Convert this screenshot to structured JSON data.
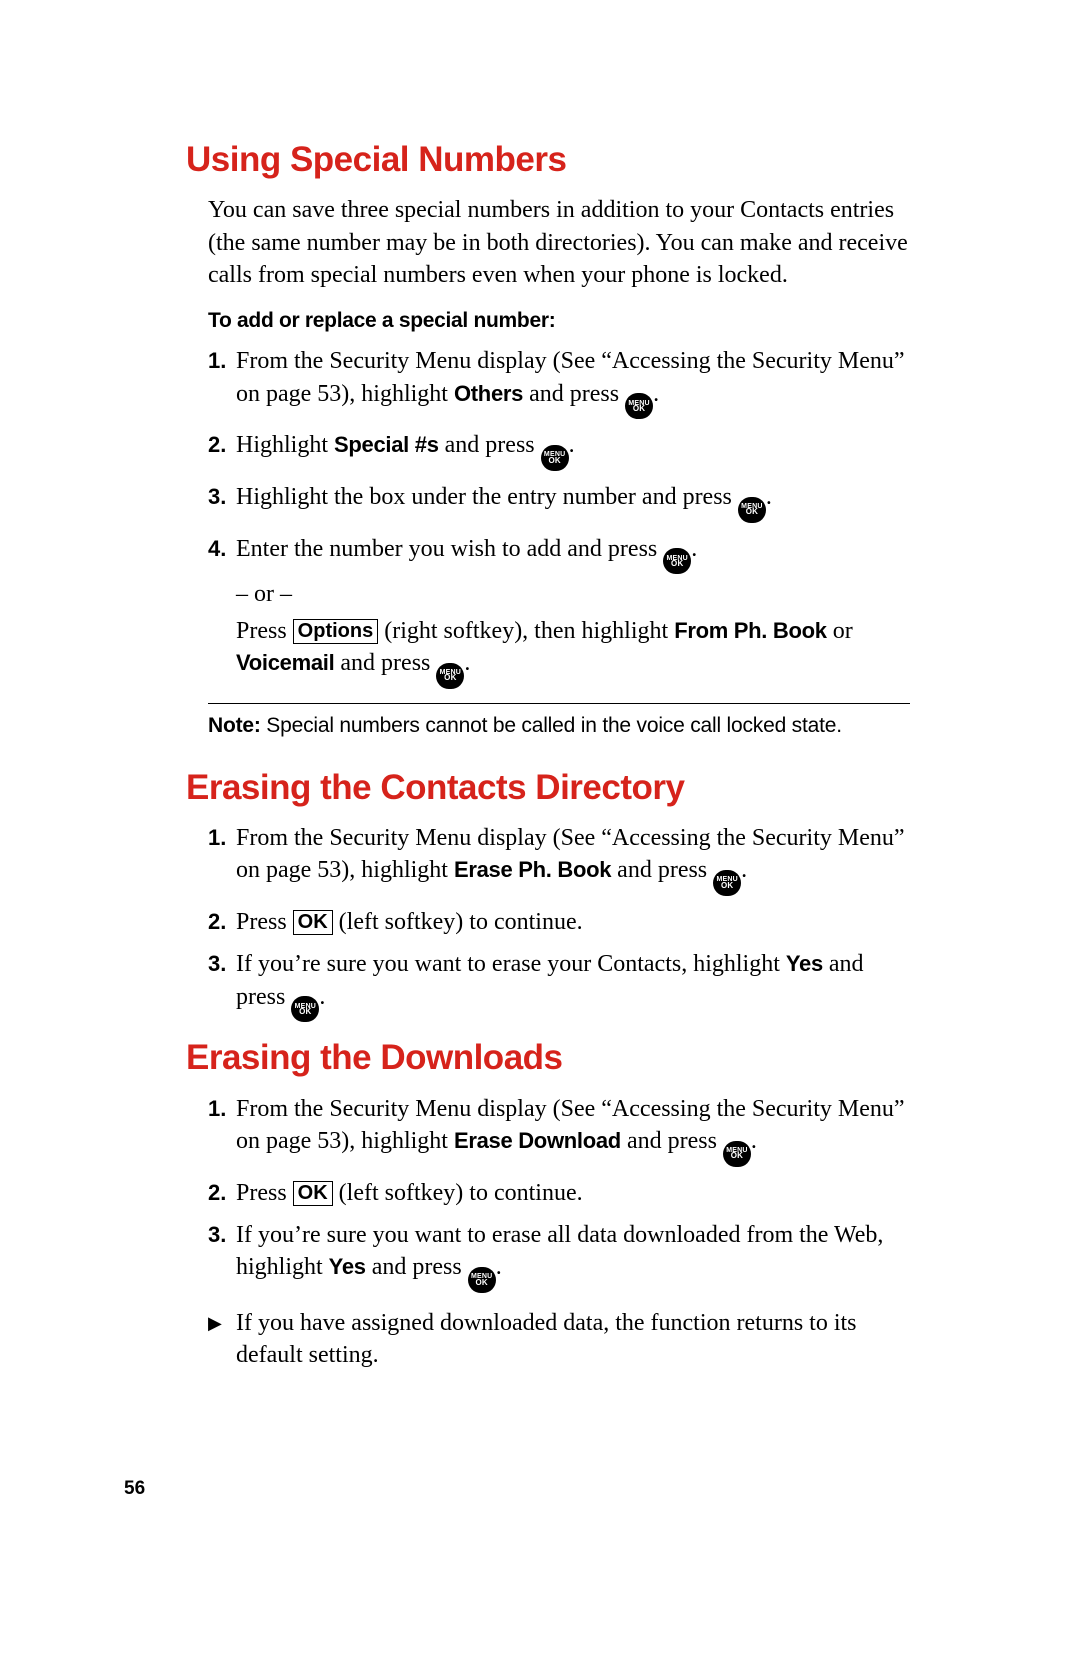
{
  "page_number": "56",
  "menu_ok_label_top": "MENU",
  "menu_ok_label_bottom": "OK",
  "sections": {
    "s1": {
      "heading": "Using Special Numbers",
      "intro": "You can save three special numbers in addition to your Contacts entries (the same number may be in both directories). You can make and receive calls from special numbers even when your phone is locked.",
      "subhead": "To add or replace a special number:",
      "steps": {
        "n1": "1.",
        "t1a": "From the Security Menu display (See “Accessing the Security Menu” on page 53), highlight ",
        "t1b": "Others",
        "t1c": " and press ",
        "t1d": ".",
        "n2": "2.",
        "t2a": "Highlight ",
        "t2b": "Special #s",
        "t2c": " and press ",
        "t2d": ".",
        "n3": "3.",
        "t3a": "Highlight the box under the entry number and press ",
        "t3b": ".",
        "n4": "4.",
        "t4a": "Enter the number you wish to add and press ",
        "t4b": ".",
        "t4or": "– or –",
        "t4c": "Press ",
        "t4key": "Options",
        "t4d": " (right softkey), then highlight ",
        "t4e": "From Ph. Book",
        "t4f": " or ",
        "t4g": "Voicemail",
        "t4h": " and press ",
        "t4i": "."
      },
      "note_label": "Note:",
      "note_text": " Special numbers cannot be called in the voice call locked state."
    },
    "s2": {
      "heading": "Erasing the Contacts Directory",
      "steps": {
        "n1": "1.",
        "t1a": "From the Security Menu display (See “Accessing the Security Menu” on page 53), highlight ",
        "t1b": "Erase Ph. Book",
        "t1c": " and press ",
        "t1d": ".",
        "n2": "2.",
        "t2a": "Press ",
        "t2key": "OK",
        "t2b": " (left softkey) to continue.",
        "n3": "3.",
        "t3a": "If you’re sure you want to erase your Contacts, highlight ",
        "t3b": "Yes",
        "t3c": " and press ",
        "t3d": "."
      }
    },
    "s3": {
      "heading": "Erasing the Downloads",
      "steps": {
        "n1": "1.",
        "t1a": "From the Security Menu display (See “Accessing the Security Menu” on page 53), highlight ",
        "t1b": "Erase Download",
        "t1c": " and press ",
        "t1d": ".",
        "n2": "2.",
        "t2a": "Press ",
        "t2key": "OK",
        "t2b": " (left softkey) to continue.",
        "n3": "3.",
        "t3a": "If you’re sure you want to erase all data downloaded from the Web, highlight ",
        "t3b": "Yes",
        "t3c": " and press ",
        "t3d": "."
      },
      "bullet": "If you have assigned downloaded data, the function returns to its default setting."
    }
  }
}
